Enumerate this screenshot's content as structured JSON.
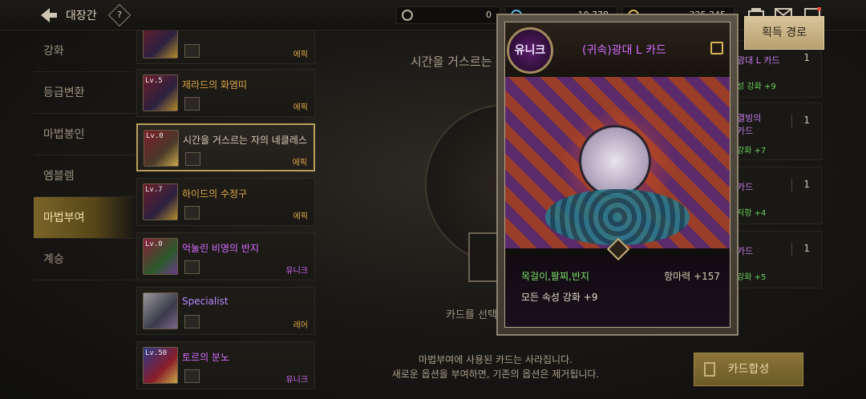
{
  "header": {
    "title": "대장간",
    "help": "?",
    "currencies": [
      {
        "name": "cera-icon",
        "value": "0"
      },
      {
        "name": "blue-gem-icon",
        "value": "10,778"
      },
      {
        "name": "gold-icon",
        "value": "325,345"
      }
    ]
  },
  "sidebar": {
    "items": [
      {
        "label": "강화"
      },
      {
        "label": "등급변환"
      },
      {
        "label": "마법봉인"
      },
      {
        "label": "엠블렘"
      },
      {
        "label": "마법부여"
      },
      {
        "label": "계승"
      }
    ],
    "active_index": 4
  },
  "cards": [
    {
      "level": "",
      "name": "",
      "grade": "에픽",
      "style": "epic"
    },
    {
      "level": "Lv.5",
      "name": "제라드의 화염띠",
      "grade": "에픽",
      "style": "epic"
    },
    {
      "level": "Lv.0",
      "name": "시간을 거스르는 자의 네클레스",
      "grade": "에픽",
      "style": "epic",
      "selected": true
    },
    {
      "level": "Lv.7",
      "name": "하이드의 수정구",
      "grade": "에픽",
      "style": "epic"
    },
    {
      "level": "Lv.0",
      "name": "억눌린 비명의 반지",
      "grade": "유니크",
      "style": "unique"
    },
    {
      "level": "",
      "name": "Specialist",
      "grade": "레어",
      "style": "rare"
    },
    {
      "level": "Lv.50",
      "name": "토르의 분노",
      "grade": "유니크",
      "style": "unique"
    }
  ],
  "center": {
    "title": "시간을 거스르는",
    "hint": "카드를 선택",
    "notice_line1": "마법부여에 사용된 카드는 사라집니다.",
    "notice_line2": "새로운 옵션을 부여하면, 기존의 옵션은 제거됩니다."
  },
  "right_list": [
    {
      "name": "광대 L 카드",
      "stat": "성 강화 +9",
      "count": "1"
    },
    {
      "name": "결빙의",
      "name2": "카드",
      "stat": "강화 +7",
      "count": "1"
    },
    {
      "name": "카드",
      "stat": "저항 +4",
      "count": "1"
    },
    {
      "name": "카드",
      "stat": "강화 +5",
      "count": "1"
    }
  ],
  "buttons": {
    "acquire": "획득 경로",
    "synthesize": "카드합성"
  },
  "popup": {
    "badge": "유니크",
    "title": "(귀속)광대 L 카드",
    "equip_slots": "목걸이,팔찌,반지",
    "resist": "항마력 +157",
    "element": "모든 속성 강화 +9"
  }
}
